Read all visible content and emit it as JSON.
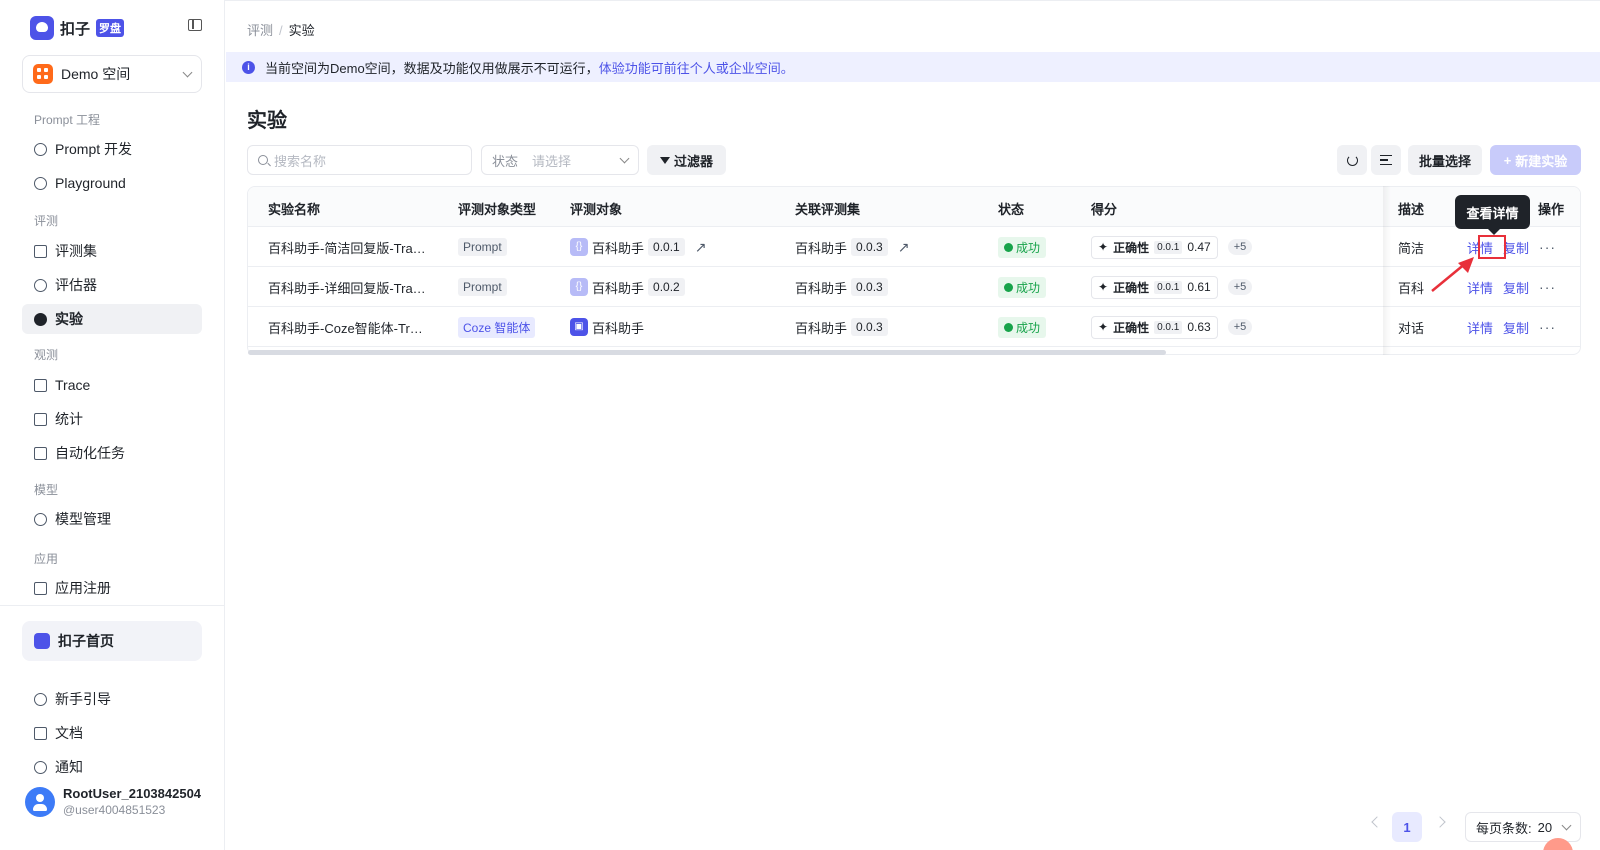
{
  "sidebar": {
    "logo_text": "扣子",
    "logo_badge": "罗盘",
    "space": "Demo 空间",
    "groups": {
      "prompt": "Prompt 工程",
      "eval": "评测",
      "observe": "观测",
      "model": "模型",
      "app": "应用"
    },
    "items": {
      "prompt_dev": "Prompt 开发",
      "playground": "Playground",
      "eval_set": "评测集",
      "evaluator": "评估器",
      "experiment": "实验",
      "trace": "Trace",
      "stats": "统计",
      "auto_task": "自动化任务",
      "model_mgmt": "模型管理",
      "app_register": "应用注册"
    },
    "home": "扣子首页",
    "guide": "新手引导",
    "docs": "文档",
    "notify": "通知",
    "user": {
      "name": "RootUser_2103842504",
      "id": "@user4004851523"
    }
  },
  "breadcrumb": {
    "parent": "评测",
    "sep": "/",
    "current": "实验"
  },
  "banner": {
    "text": "当前空间为Demo空间，数据及功能仅用做展示不可运行，",
    "link": "体验功能可前往个人或企业空间。"
  },
  "page_title": "实验",
  "toolbar": {
    "search_placeholder": "搜索名称",
    "status_label": "状态",
    "status_placeholder": "请选择",
    "filter": "过滤器",
    "batch": "批量选择",
    "new": "新建实验"
  },
  "table": {
    "headers": {
      "name": "实验名称",
      "type": "评测对象类型",
      "object": "评测对象",
      "dataset": "关联评测集",
      "status": "状态",
      "score": "得分",
      "desc": "描述",
      "ops": "操作"
    },
    "rows": [
      {
        "name": "百科助手-简洁回复版-Tra…",
        "type": "Prompt",
        "object": "百科助手",
        "object_ver": "0.0.1",
        "dataset": "百科助手",
        "dataset_ver": "0.0.3",
        "status": "成功",
        "score_name": "正确性",
        "score_ver": "0.0.1",
        "score": "0.47",
        "more": "+5",
        "desc": "简洁",
        "detail": "详情",
        "copy": "复制"
      },
      {
        "name": "百科助手-详细回复版-Tra…",
        "type": "Prompt",
        "object": "百科助手",
        "object_ver": "0.0.2",
        "dataset": "百科助手",
        "dataset_ver": "0.0.3",
        "status": "成功",
        "score_name": "正确性",
        "score_ver": "0.0.1",
        "score": "0.61",
        "more": "+5",
        "desc": "百科",
        "detail": "详情",
        "copy": "复制"
      },
      {
        "name": "百科助手-Coze智能体-Tr…",
        "type": "Coze 智能体",
        "object": "百科助手",
        "object_ver": "",
        "dataset": "百科助手",
        "dataset_ver": "0.0.3",
        "status": "成功",
        "score_name": "正确性",
        "score_ver": "0.0.1",
        "score": "0.63",
        "more": "+5",
        "desc": "对话",
        "detail": "详情",
        "copy": "复制"
      }
    ]
  },
  "tooltip": "查看详情",
  "pagination": {
    "current": "1",
    "page_size_label": "每页条数:",
    "page_size": "20"
  },
  "colors": {
    "accent": "#4d53e8",
    "success": "#17a34a",
    "highlight": "#e8303a"
  }
}
